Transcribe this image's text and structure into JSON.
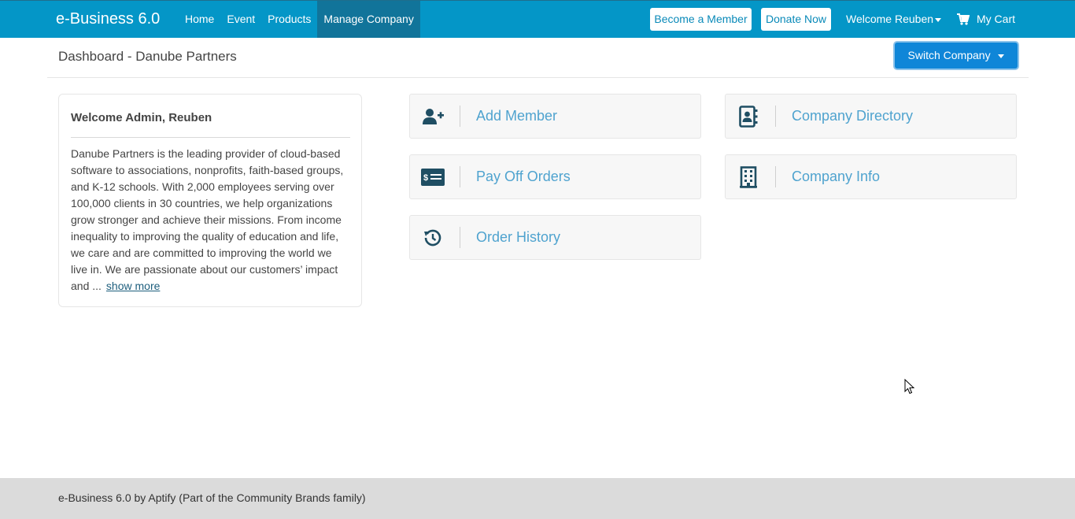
{
  "app": {
    "brand": "e-Business 6.0"
  },
  "nav": {
    "links": [
      "Home",
      "Event",
      "Products",
      "Manage Company"
    ],
    "become_member": "Become a Member",
    "donate_now": "Donate Now",
    "welcome": "Welcome Reuben",
    "cart": "My Cart"
  },
  "header": {
    "title": "Dashboard - Danube Partners",
    "switch_company": "Switch Company"
  },
  "welcome_card": {
    "title": "Welcome Admin, Reuben",
    "text": "Danube Partners is the leading provider of cloud-based software to associations, nonprofits, faith-based groups, and K-12 schools. With 2,000 employees serving over 100,000 clients in 30 countries, we help organizations grow stronger and achieve their missions. From income inequality to improving the quality of education and life, we care and are committed to improving the world we live in. We are passionate about our customers’ impact and ...",
    "show_more": "show more"
  },
  "tiles": {
    "add_member": "Add Member",
    "pay_off_orders": "Pay Off Orders",
    "order_history": "Order History",
    "company_directory": "Company Directory",
    "company_info": "Company Info"
  },
  "footer": {
    "text": "e-Business 6.0 by Aptify (Part of the Community Brands family)"
  },
  "colors": {
    "navbar": "#0496c7",
    "active_nav": "#11749a",
    "primary_button": "#0f86d8",
    "tile_text": "#4fa3cf",
    "icon": "#1f4e63"
  },
  "icons": {
    "add_member": "user-plus-icon",
    "pay_off_orders": "money-check-icon",
    "order_history": "history-icon",
    "company_directory": "address-book-icon",
    "company_info": "building-icon",
    "cart": "cart-icon"
  }
}
